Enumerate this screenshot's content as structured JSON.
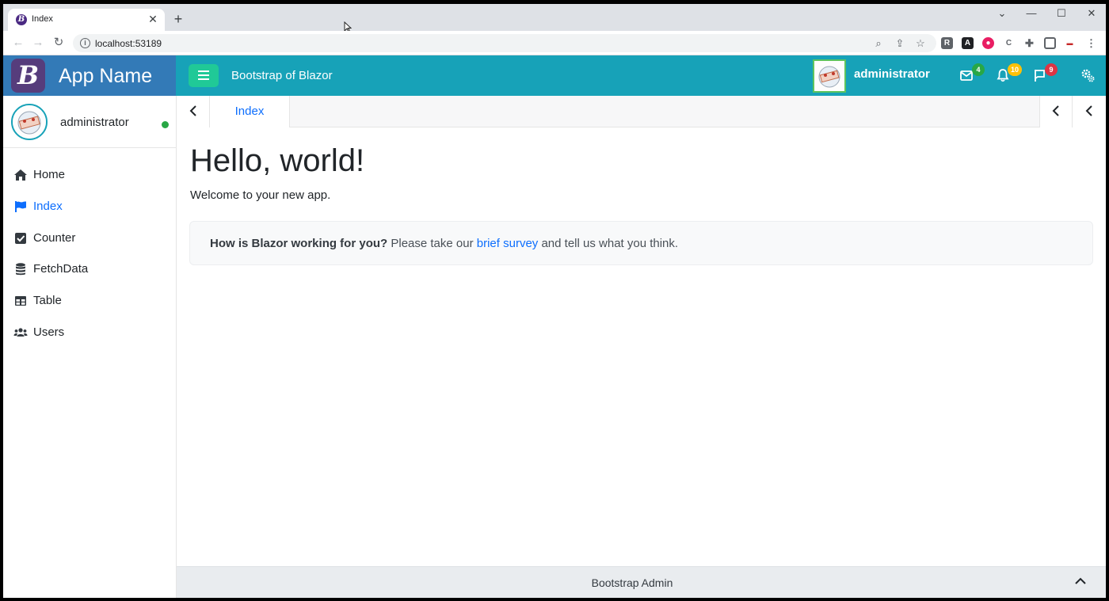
{
  "browser": {
    "tab_title": "Index",
    "tab_close": "✕",
    "new_tab": "+",
    "url": "localhost:53189",
    "window_controls": {
      "minimize": "—",
      "maximize": "☐",
      "close": "✕",
      "dropdown": "⌄"
    }
  },
  "header": {
    "app_name": "App Name",
    "logo_letter": "B",
    "title": "Bootstrap of Blazor",
    "username": "administrator",
    "badges": {
      "messages": "4",
      "notifications": "10",
      "tasks": "9"
    },
    "colors": {
      "header": "#17a2b8",
      "brand": "#337ab7",
      "toggle": "#20c997",
      "badge_messages": "#28a745",
      "badge_notifications": "#ffc107",
      "badge_tasks": "#dc3545"
    }
  },
  "sidebar": {
    "username": "administrator",
    "items": [
      {
        "label": "Home",
        "icon": "home-icon"
      },
      {
        "label": "Index",
        "icon": "flag-icon",
        "active": true
      },
      {
        "label": "Counter",
        "icon": "check-square-icon"
      },
      {
        "label": "FetchData",
        "icon": "database-icon"
      },
      {
        "label": "Table",
        "icon": "table-icon"
      },
      {
        "label": "Users",
        "icon": "users-icon"
      }
    ]
  },
  "tabs": {
    "active_tab": "Index"
  },
  "main": {
    "heading": "Hello, world!",
    "welcome": "Welcome to your new app.",
    "survey": {
      "question": "How is Blazor working for you?",
      "prefix": "Please take our",
      "link": "brief survey",
      "suffix": "and tell us what you think."
    }
  },
  "footer": {
    "text": "Bootstrap Admin"
  }
}
